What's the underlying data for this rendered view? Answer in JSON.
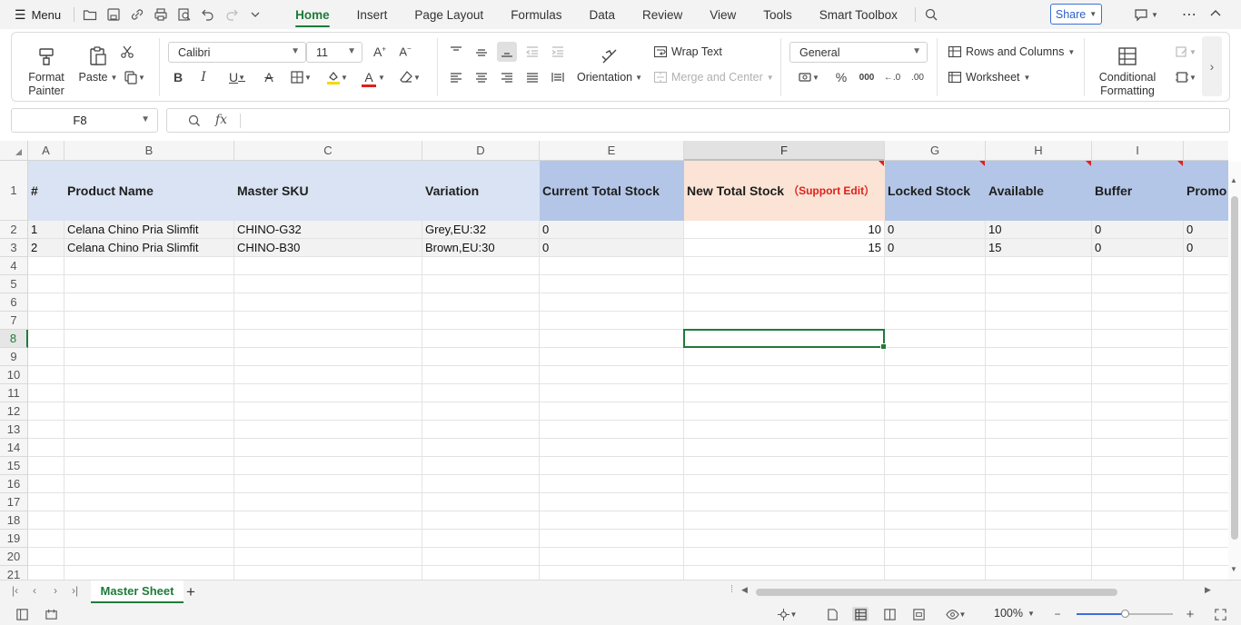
{
  "menubar": {
    "menu_label": "Menu",
    "tabs": [
      "Home",
      "Insert",
      "Page Layout",
      "Formulas",
      "Data",
      "Review",
      "View",
      "Tools",
      "Smart Toolbox"
    ],
    "active_tab": "Home",
    "share_label": "Share"
  },
  "ribbon": {
    "format_painter": "Format\nPainter",
    "paste": "Paste",
    "font_name": "Calibri",
    "font_size": "11",
    "wrap_text": "Wrap Text",
    "merge_center": "Merge and Center",
    "orientation": "Orientation",
    "number_format": "General",
    "rows_columns": "Rows and Columns",
    "worksheet": "Worksheet",
    "conditional_formatting": "Conditional\nFormatting",
    "accent_color": "#1f7a3a",
    "font_color_bar": "#e0201d",
    "highlight_color_bar": "#f5d800"
  },
  "formula_bar": {
    "name_box": "F8",
    "fx_label": "fx",
    "formula": ""
  },
  "grid": {
    "columns": [
      "A",
      "B",
      "C",
      "D",
      "E",
      "F",
      "G",
      "H",
      "I"
    ],
    "selected_column": "F",
    "rows": [
      "1",
      "2",
      "3",
      "4",
      "5",
      "6",
      "7",
      "8",
      "9",
      "10",
      "11",
      "12",
      "13",
      "14",
      "15",
      "16",
      "17",
      "18",
      "19",
      "20",
      "21"
    ],
    "selected_row": "8",
    "active_cell": "F8",
    "header_row": {
      "A": "#",
      "B": "Product Name",
      "C": "Master SKU",
      "D": "Variation",
      "E": "Current Total Stock",
      "F": "New Total Stock",
      "F_note": "（Support Edit）",
      "G": "Locked Stock",
      "H": "Available",
      "I": "Buffer",
      "J": "Promo"
    },
    "data_rows": [
      {
        "A": "1",
        "B": "Celana Chino Pria Slimfit",
        "C": "CHINO-G32",
        "D": "Grey,EU:32",
        "E": "0",
        "F": "10",
        "G": "0",
        "H": "10",
        "I": "0",
        "J": "0"
      },
      {
        "A": "2",
        "B": "Celana Chino Pria Slimfit",
        "C": "CHINO-B30",
        "D": "Brown,EU:30",
        "E": "0",
        "F": "15",
        "G": "0",
        "H": "15",
        "I": "0",
        "J": "0"
      }
    ],
    "header_colors": {
      "light_blue": "#dae3f3",
      "medium_blue": "#b4c6e7",
      "peach": "#fbe4d5",
      "row_gray": "#f2f2f2"
    }
  },
  "sheets": {
    "tabs": [
      "Master Sheet"
    ],
    "active": "Master Sheet"
  },
  "statusbar": {
    "zoom": "100%",
    "zoom_fraction": 0.5
  }
}
